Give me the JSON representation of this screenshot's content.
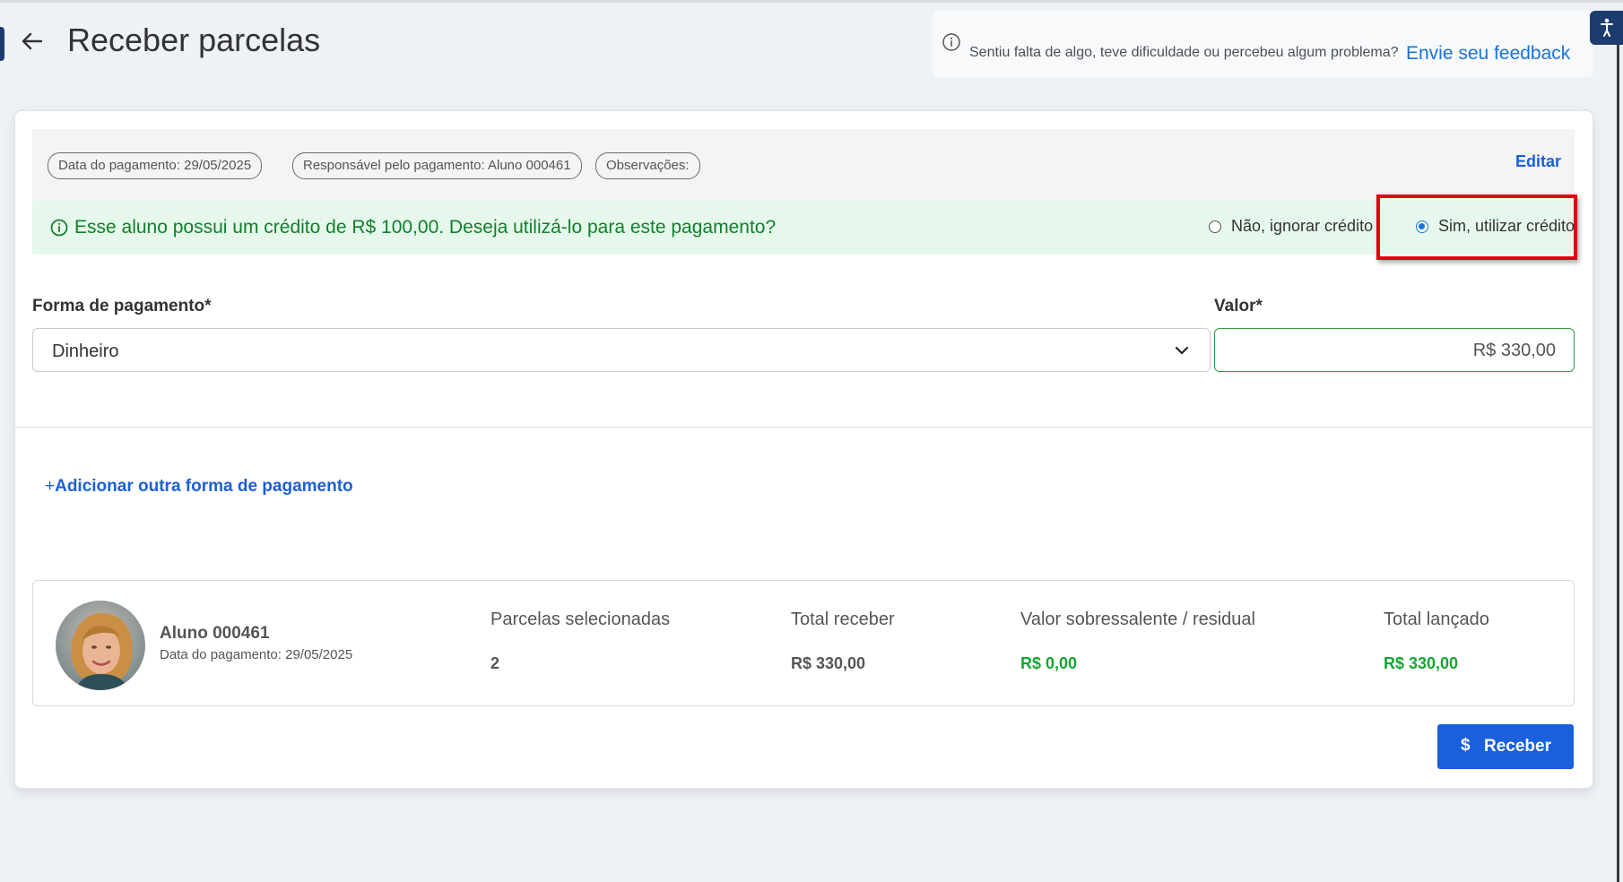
{
  "page": {
    "title": "Receber parcelas"
  },
  "feedback": {
    "question": "Sentiu falta de algo, teve dificuldade ou percebeu algum problema?",
    "link_label": "Envie seu feedback"
  },
  "payment_info": {
    "chips": [
      "Data do pagamento: 29/05/2025",
      "Responsável pelo pagamento: Aluno 000461",
      "Observações:"
    ],
    "edit_label": "Editar"
  },
  "credit_notice": {
    "message": "Esse aluno possui um crédito de R$ 100,00. Deseja utilizá-lo para este pagamento?",
    "options": [
      {
        "label": "Não, ignorar crédito",
        "selected": false
      },
      {
        "label": "Sim, utilizar crédito",
        "selected": true
      }
    ]
  },
  "form": {
    "payment_method_label": "Forma de pagamento*",
    "payment_method_value": "Dinheiro",
    "amount_label": "Valor*",
    "amount_value": "R$ 330,00",
    "add_method_label": "Adicionar outra forma de pagamento"
  },
  "summary": {
    "student_name": "Aluno 000461",
    "payment_date": "Data do pagamento: 29/05/2025",
    "columns": [
      {
        "header": "Parcelas selecionadas",
        "value": "2"
      },
      {
        "header": "Total receber",
        "value": "R$ 330,00"
      },
      {
        "header": "Valor sobressalente / residual",
        "value": "R$ 0,00"
      },
      {
        "header": "Total lançado",
        "value": "R$ 330,00"
      }
    ]
  },
  "actions": {
    "receive_label": "Receber"
  },
  "colors": {
    "accent_blue": "#1a5fdc",
    "success_green": "#13a532",
    "credit_bg": "#e6f8ec",
    "highlight_red": "#e1000f"
  },
  "icons": [
    "back-arrow-icon",
    "info-icon",
    "accessibility-icon",
    "chevron-down-icon",
    "plus-icon",
    "dollar-icon"
  ]
}
